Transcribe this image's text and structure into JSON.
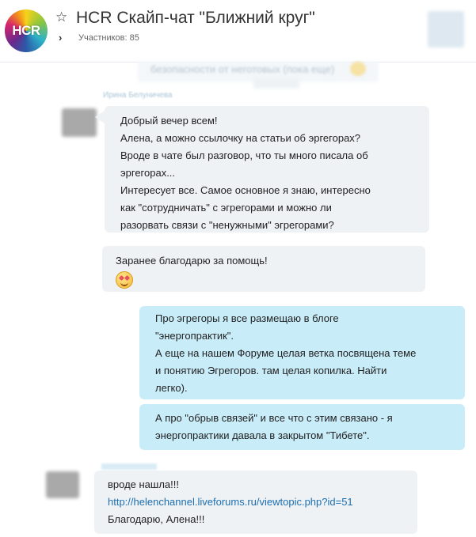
{
  "header": {
    "logo_text": "HCR",
    "title": "HCR Скайп-чат \"Ближний круг\"",
    "participants": "Участников: 85"
  },
  "top_remnant": {
    "text": "безопасности от неготовых (пока еще)"
  },
  "sender_name": "Ирина Белуничева",
  "messages": [
    {
      "lines": [
        "Добрый вечер всем!",
        "Алена, а можно ссылочку на статьи об эргегорах?",
        "Вроде в чате был разговор, что ты много писала об",
        "эргегорах...",
        "Интересует все. Самое основное я знаю, интересно",
        "как \"сотрудничать\" с эгрегорами и можно ли",
        "разорвать связи с \"ненужными\" эгрегорами?"
      ]
    },
    {
      "lines": [
        "Заранее благодарю за помощь!"
      ],
      "emoji": "smiling-face-with-heart-eyes"
    },
    {
      "lines": [
        "Про эгрегоры я все размещаю в блоге",
        "\"энергопрактик\".",
        "А еще на нашем Форуме целая ветка посвящена теме",
        "и понятию Эгрегоров. там целая копилка. Найти",
        "легко)."
      ]
    },
    {
      "lines": [
        "А про \"обрыв связей\" и все что с этим связано - я",
        "энергопрактики давала в закрытом \"Тибете\"."
      ]
    },
    {
      "lines": [
        "вроде нашла!!!"
      ],
      "link": "http://helenchannel.liveforums.ru/viewtopic.php?id=51",
      "after": "Благодарю, Алена!!!"
    }
  ]
}
